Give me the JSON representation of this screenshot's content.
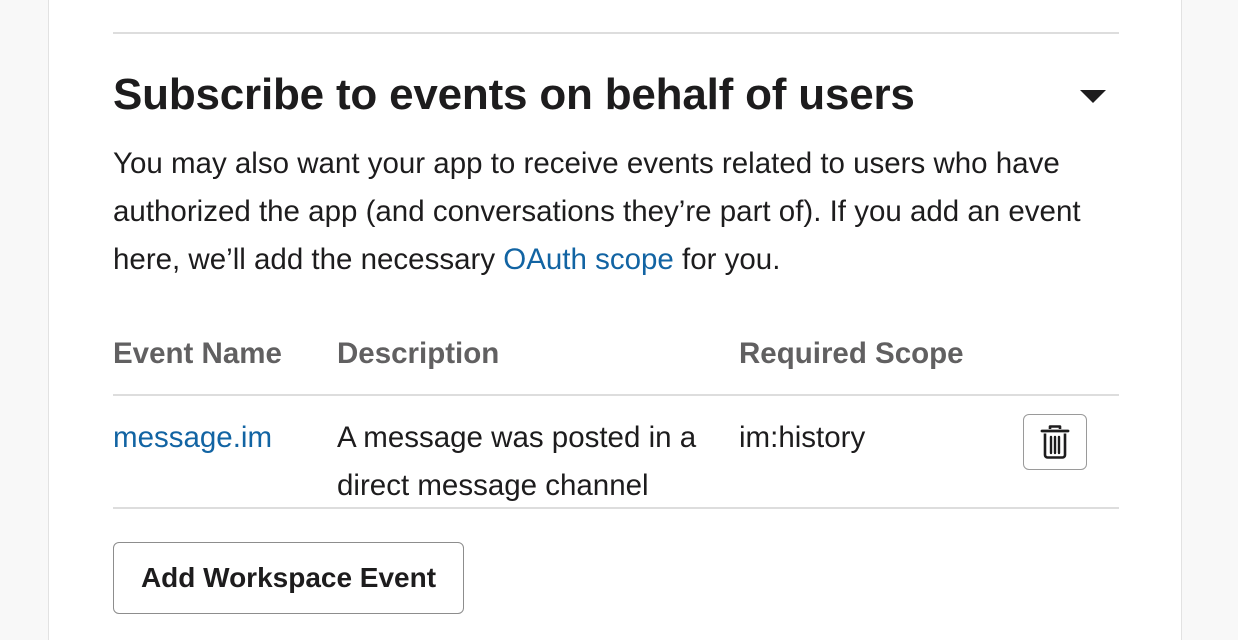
{
  "section": {
    "title": "Subscribe to events on behalf of users",
    "toggle_icon": "caret-down-icon",
    "description_part1": "You may also want your app to receive events related to users who have authorized the app (and conversations they’re part of). If you add an event here, we’ll add the necessary ",
    "description_link": "OAuth scope",
    "description_part2": " for you."
  },
  "table": {
    "headers": {
      "name": "Event Name",
      "description": "Description",
      "scope": "Required Scope"
    },
    "rows": [
      {
        "name": "message.im",
        "description": "A message was posted in a direct message channel",
        "scope": "im:history",
        "action_icon": "trash-icon"
      }
    ]
  },
  "actions": {
    "add_label": "Add Workspace Event"
  },
  "colors": {
    "link": "#1264a3",
    "text": "#1d1c1d",
    "header_text": "#616061",
    "divider": "#dddddd"
  }
}
